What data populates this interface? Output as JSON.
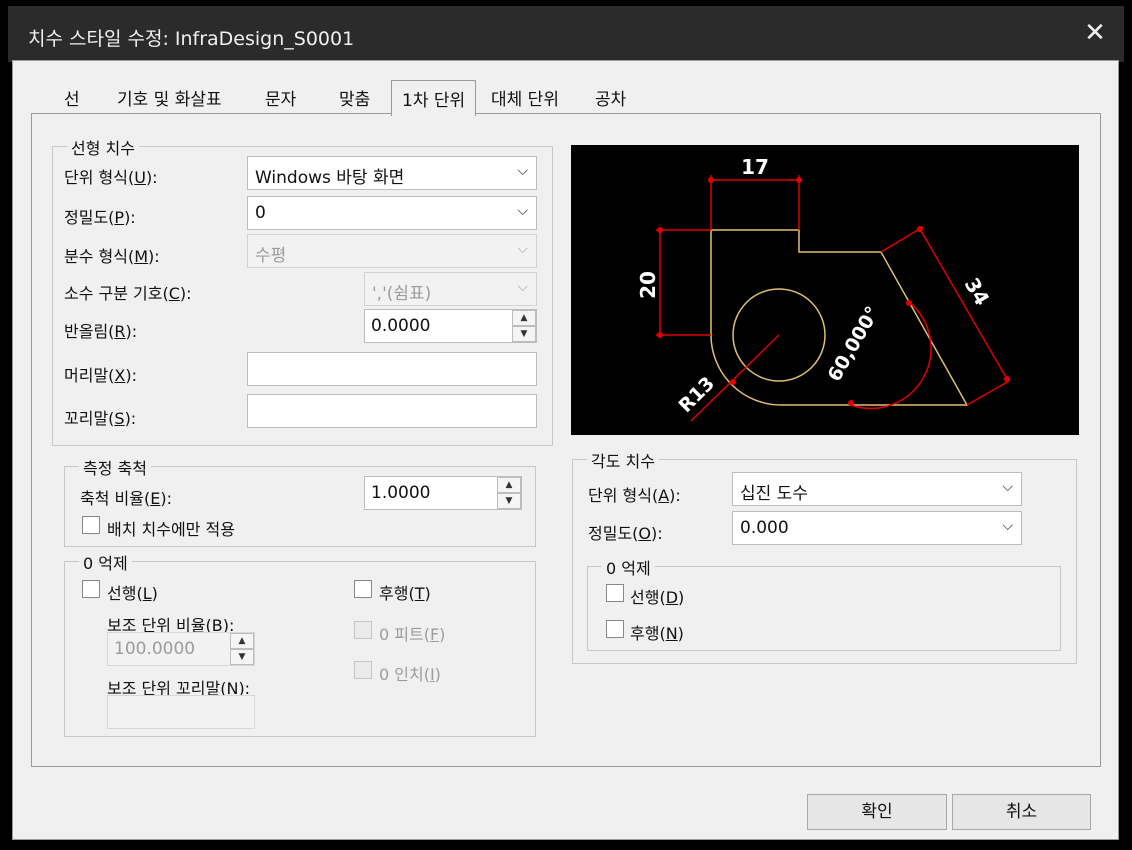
{
  "window": {
    "title": "치수 스타일 수정: InfraDesign_S0001",
    "close_symbol": "✕"
  },
  "tabs": [
    {
      "label": "선"
    },
    {
      "label": "기호 및 화살표"
    },
    {
      "label": "문자"
    },
    {
      "label": "맞춤"
    },
    {
      "label": "1차 단위",
      "active": true
    },
    {
      "label": "대체 단위"
    },
    {
      "label": "공차"
    }
  ],
  "linear": {
    "group_label": "선형 치수",
    "unit_format": {
      "label_pre": "단위 형식(",
      "key": "U",
      "label_post": "):",
      "value": "Windows 바탕 화면"
    },
    "precision": {
      "label_pre": "정밀도(",
      "key": "P",
      "label_post": "):",
      "value": "0"
    },
    "fraction_format": {
      "label_pre": "분수 형식(",
      "key": "M",
      "label_post": "):",
      "value": "수평"
    },
    "decimal_separator": {
      "label_pre": "소수 구분 기호(",
      "key": "C",
      "label_post": "):",
      "value": "','(쉼표)"
    },
    "round_off": {
      "label_pre": "반올림(",
      "key": "R",
      "label_post": "):",
      "value": "0.0000"
    },
    "prefix": {
      "label_pre": "머리말(",
      "key": "X",
      "label_post": "):",
      "value": ""
    },
    "suffix": {
      "label_pre": "꼬리말(",
      "key": "S",
      "label_post": "):",
      "value": ""
    }
  },
  "measurement_scale": {
    "group_label": "측정 축척",
    "scale_factor": {
      "label_pre": "축척 비율(",
      "key": "E",
      "label_post": "):",
      "value": "1.0000"
    },
    "layout_only": {
      "label": "배치 치수에만 적용",
      "checked": false
    }
  },
  "zero_suppression": {
    "group_label": "0 억제",
    "leading": {
      "label_pre": "선행(",
      "key": "L",
      "label_post": ")",
      "checked": false
    },
    "trailing": {
      "label_pre": "후행(",
      "key": "T",
      "label_post": ")",
      "checked": false
    },
    "sub_unit_factor": {
      "label_pre": "보조 단위 비율(",
      "key": "B",
      "label_post": "):",
      "value": "100.0000"
    },
    "sub_unit_suffix": {
      "label_pre": "보조 단위 꼬리말(",
      "key": "N",
      "label_post": "):",
      "value": ""
    },
    "zero_feet": {
      "label_pre": "0 피트(",
      "key": "F",
      "label_post": ")",
      "checked": false
    },
    "zero_inches": {
      "label_pre": "0 인치(",
      "key": "I",
      "label_post": ")",
      "checked": false
    }
  },
  "angular": {
    "group_label": "각도 치수",
    "unit_format": {
      "label_pre": "단위 형식(",
      "key": "A",
      "label_post": "):",
      "value": "십진 도수"
    },
    "precision": {
      "label_pre": "정밀도(",
      "key": "O",
      "label_post": "):",
      "value": "0.000"
    },
    "zero_suppression": {
      "group_label": "0 억제",
      "leading": {
        "label_pre": "선행(",
        "key": "D",
        "label_post": ")",
        "checked": false
      },
      "trailing": {
        "label_pre": "후행(",
        "key": "N",
        "label_post": ")",
        "checked": false
      }
    }
  },
  "preview": {
    "dim_top": "17",
    "dim_left": "20",
    "dim_right": "34",
    "dim_angle": "60,000°",
    "dim_radius": "R13",
    "colors": {
      "background": "#000000",
      "geometry": "#e0c070",
      "dimension": "#e00000",
      "text": "#ffffff"
    }
  },
  "buttons": {
    "ok": "확인",
    "cancel": "취소"
  },
  "icons": {
    "dropdown": "chevron-down-icon",
    "spin_up": "▲",
    "spin_down": "▼",
    "chevron": "⌵"
  }
}
